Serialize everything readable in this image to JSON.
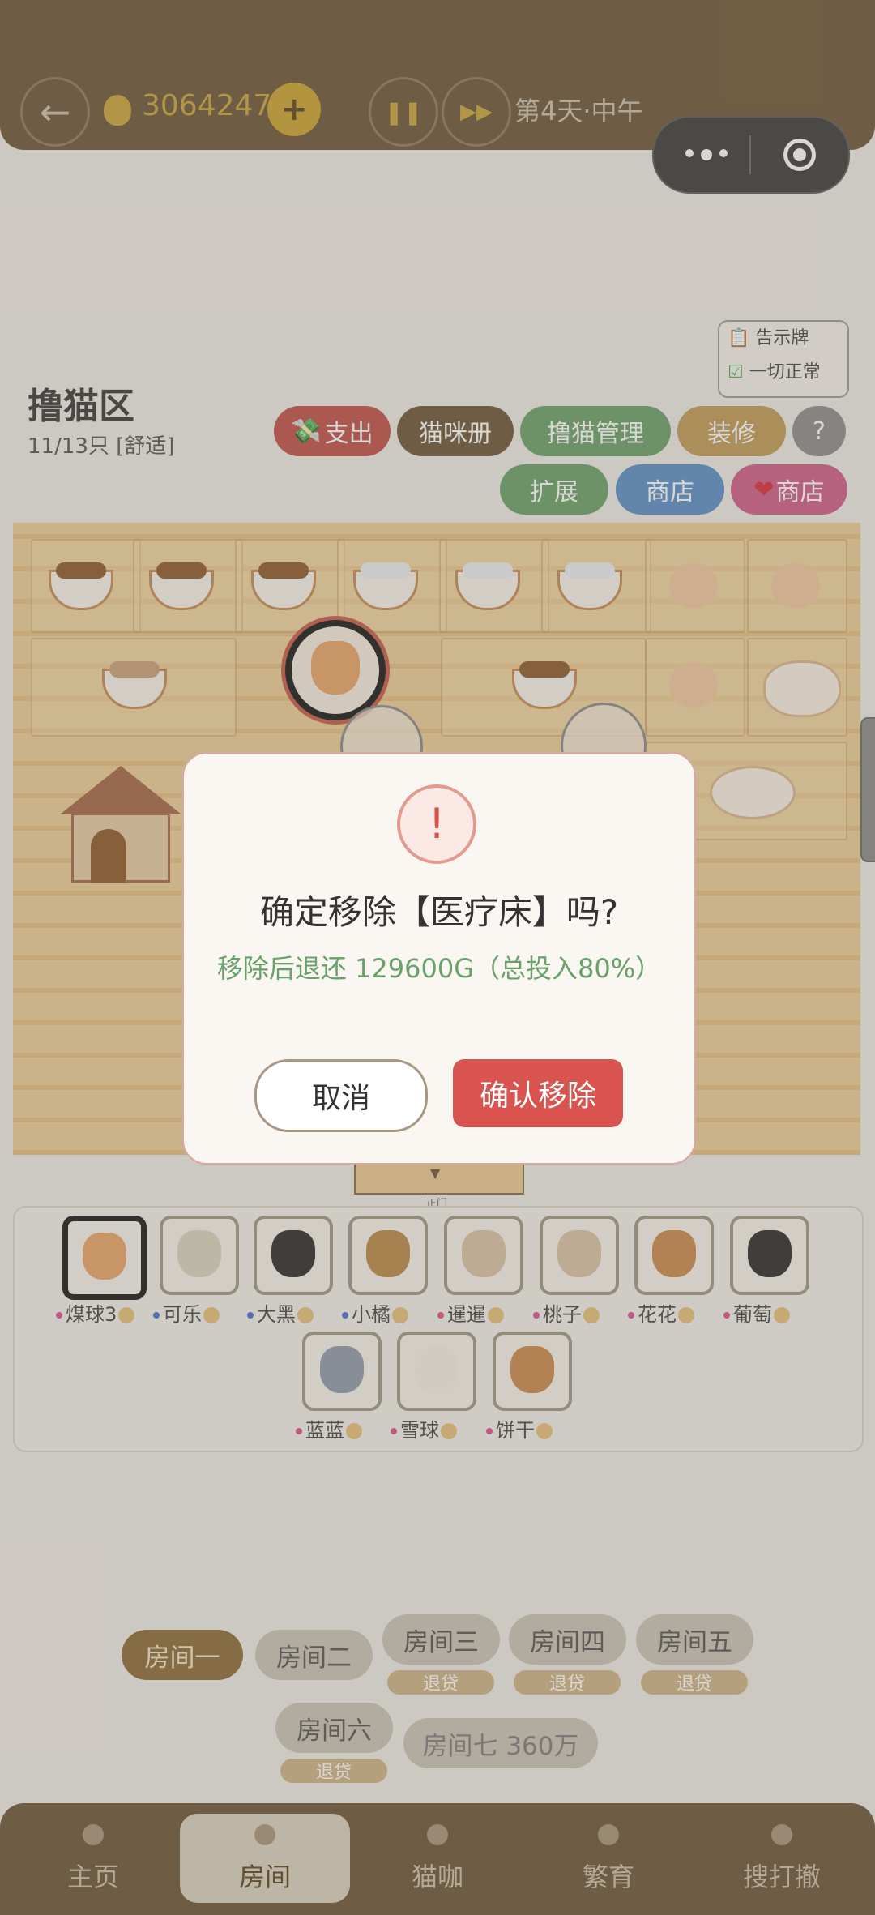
{
  "header": {
    "coins": "3064247",
    "day": "第4天·中午",
    "icons": {
      "back": "back-arrow-icon",
      "coin": "money-bag-icon",
      "pause": "pause-icon",
      "fast_forward": "fast-forward-icon",
      "more": "more-dots-icon",
      "target": "target-icon"
    }
  },
  "area": {
    "title": "撸猫区",
    "subtitle": "11/13只 [舒适]",
    "notice": {
      "title": "告示牌",
      "status": "一切正常"
    },
    "buttons": [
      {
        "label": "支出",
        "color": "#c0504a"
      },
      {
        "label": "猫咪册",
        "color": "#6b5638"
      },
      {
        "label": "撸猫管理",
        "color": "#6aa06a"
      },
      {
        "label": "装修",
        "color": "#c09a56"
      },
      {
        "label": "?",
        "color": "#8d8d8d"
      },
      {
        "label": "扩展",
        "color": "#6aa06a"
      },
      {
        "label": "商店",
        "color": "#5a8fc7"
      },
      {
        "label": "商店",
        "color": "#cf5d8a"
      }
    ],
    "door_label": "正门"
  },
  "cats": [
    {
      "name": "煤球3",
      "dot": "#d9538f",
      "color": "#e8a467",
      "selected": true
    },
    {
      "name": "可乐",
      "dot": "#4a6fd1",
      "color": "#d9d3bf"
    },
    {
      "name": "大黑",
      "dot": "#4a6fd1",
      "color": "#2b2b2b"
    },
    {
      "name": "小橘",
      "dot": "#4a6fd1",
      "color": "#b98a4a"
    },
    {
      "name": "暹暹",
      "dot": "#d9538f",
      "color": "#d8c2a6"
    },
    {
      "name": "桃子",
      "dot": "#d9538f",
      "color": "#d8c2a6"
    },
    {
      "name": "花花",
      "dot": "#d9538f",
      "color": "#c9894f"
    },
    {
      "name": "葡萄",
      "dot": "#d9538f",
      "color": "#2b2b2b"
    },
    {
      "name": "蓝蓝",
      "dot": "#d9538f",
      "color": "#8e9aab"
    },
    {
      "name": "雪球",
      "dot": "#d9538f",
      "color": "#f3efe8"
    },
    {
      "name": "饼干",
      "dot": "#d9538f",
      "color": "#c9894f"
    }
  ],
  "rooms": [
    {
      "label": "房间一",
      "active": true
    },
    {
      "label": "房间二"
    },
    {
      "label": "房间三",
      "loan": "退贷"
    },
    {
      "label": "房间四",
      "loan": "退贷"
    },
    {
      "label": "房间五",
      "loan": "退贷"
    },
    {
      "label": "房间六",
      "loan": "退贷"
    },
    {
      "label": "房间七 360万",
      "locked": true
    }
  ],
  "nav": [
    {
      "label": "主页"
    },
    {
      "label": "房间",
      "active": true
    },
    {
      "label": "猫咖"
    },
    {
      "label": "繁育"
    },
    {
      "label": "搜打撤"
    }
  ],
  "modal": {
    "icon": "!",
    "title": "确定移除【医疗床】吗?",
    "desc": "移除后退还 129600G（总投入80%）",
    "cancel": "取消",
    "confirm": "确认移除"
  }
}
